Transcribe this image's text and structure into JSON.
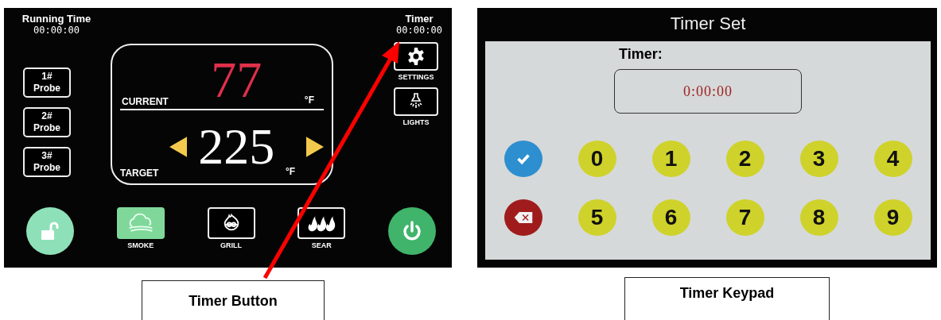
{
  "controller": {
    "running_time": {
      "label": "Running Time",
      "value": "00:00:00"
    },
    "timer": {
      "label": "Timer",
      "value": "00:00:00"
    },
    "probes": [
      {
        "number": "1#",
        "label": "Probe"
      },
      {
        "number": "2#",
        "label": "Probe"
      },
      {
        "number": "3#",
        "label": "Probe"
      }
    ],
    "display": {
      "current_label": "CURRENT",
      "current_value": "77",
      "current_unit": "°F",
      "target_label": "TARGET",
      "target_value": "225",
      "target_unit": "°F"
    },
    "side_buttons": [
      {
        "kind": "settings",
        "label": "SETTINGS"
      },
      {
        "kind": "lights",
        "label": "LIGHTS"
      }
    ],
    "bottom_buttons": [
      {
        "kind": "unlock"
      },
      {
        "kind": "smoke",
        "label": "SMOKE",
        "selected": true
      },
      {
        "kind": "grill",
        "label": "GRILL",
        "selected": false
      },
      {
        "kind": "sear",
        "label": "SEAR",
        "selected": false
      },
      {
        "kind": "power"
      }
    ]
  },
  "keypad": {
    "title": "Timer Set",
    "field_label": "Timer:",
    "value": "0:00:00",
    "rows": [
      {
        "kind": "confirm",
        "digits": [
          "0",
          "1",
          "2",
          "3",
          "4"
        ]
      },
      {
        "kind": "delete",
        "digits": [
          "5",
          "6",
          "7",
          "8",
          "9"
        ]
      }
    ]
  },
  "captions": [
    "Timer Button",
    "Timer Keypad"
  ]
}
